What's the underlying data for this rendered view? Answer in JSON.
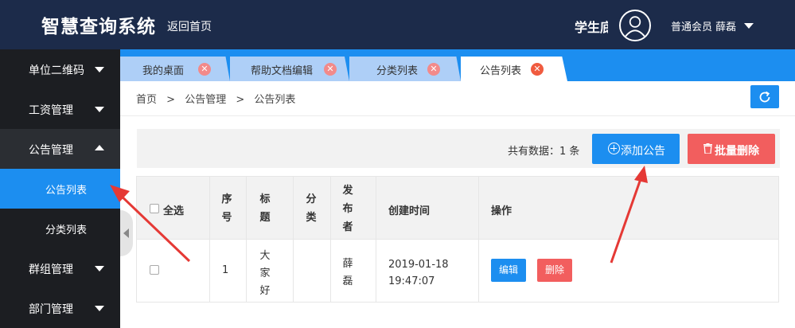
{
  "header": {
    "title": "智慧查询系统",
    "home_link": "返回首页",
    "user_role": "学生底",
    "member_label": "普通会员 薛磊"
  },
  "sidebar": {
    "items": [
      {
        "label": "单位二维码"
      },
      {
        "label": "工资管理"
      },
      {
        "label": "公告管理"
      },
      {
        "label": "公告列表"
      },
      {
        "label": "分类列表"
      },
      {
        "label": "群组管理"
      },
      {
        "label": "部门管理"
      }
    ]
  },
  "tabs": [
    {
      "label": "我的桌面"
    },
    {
      "label": "帮助文档编辑"
    },
    {
      "label": "分类列表"
    },
    {
      "label": "公告列表"
    }
  ],
  "breadcrumb": {
    "home": "首页",
    "sep": ">",
    "section": "公告管理",
    "page": "公告列表"
  },
  "toolbar": {
    "total_text": "共有数据：1 条",
    "add_label": "添加公告",
    "batch_delete_label": "批量删除"
  },
  "table": {
    "headers": {
      "select_all": "全选",
      "index": [
        "序",
        "号"
      ],
      "title": [
        "标",
        "题"
      ],
      "category": [
        "分",
        "类"
      ],
      "publisher": [
        "发",
        "布",
        "者"
      ],
      "created": "创建时间",
      "actions": "操作"
    },
    "rows": [
      {
        "index": "1",
        "title": [
          "大",
          "家",
          "好"
        ],
        "category": "",
        "publisher": [
          "薛",
          "磊"
        ],
        "created_date": "2019-01-18",
        "created_time": "19:47:07",
        "edit_label": "编辑",
        "delete_label": "删除"
      }
    ]
  },
  "colors": {
    "header_bg": "#1c2b4a",
    "sidebar_bg": "#1c1e22",
    "accent_blue": "#1c8ef0",
    "danger_red": "#f25e5e",
    "annotation_red": "#e53935"
  },
  "icons": {
    "tab_close": "close-circle-icon",
    "refresh": "refresh-icon",
    "add": "plus-circle-icon",
    "batch_delete": "trash-icon",
    "avatar": "user-avatar-icon"
  }
}
